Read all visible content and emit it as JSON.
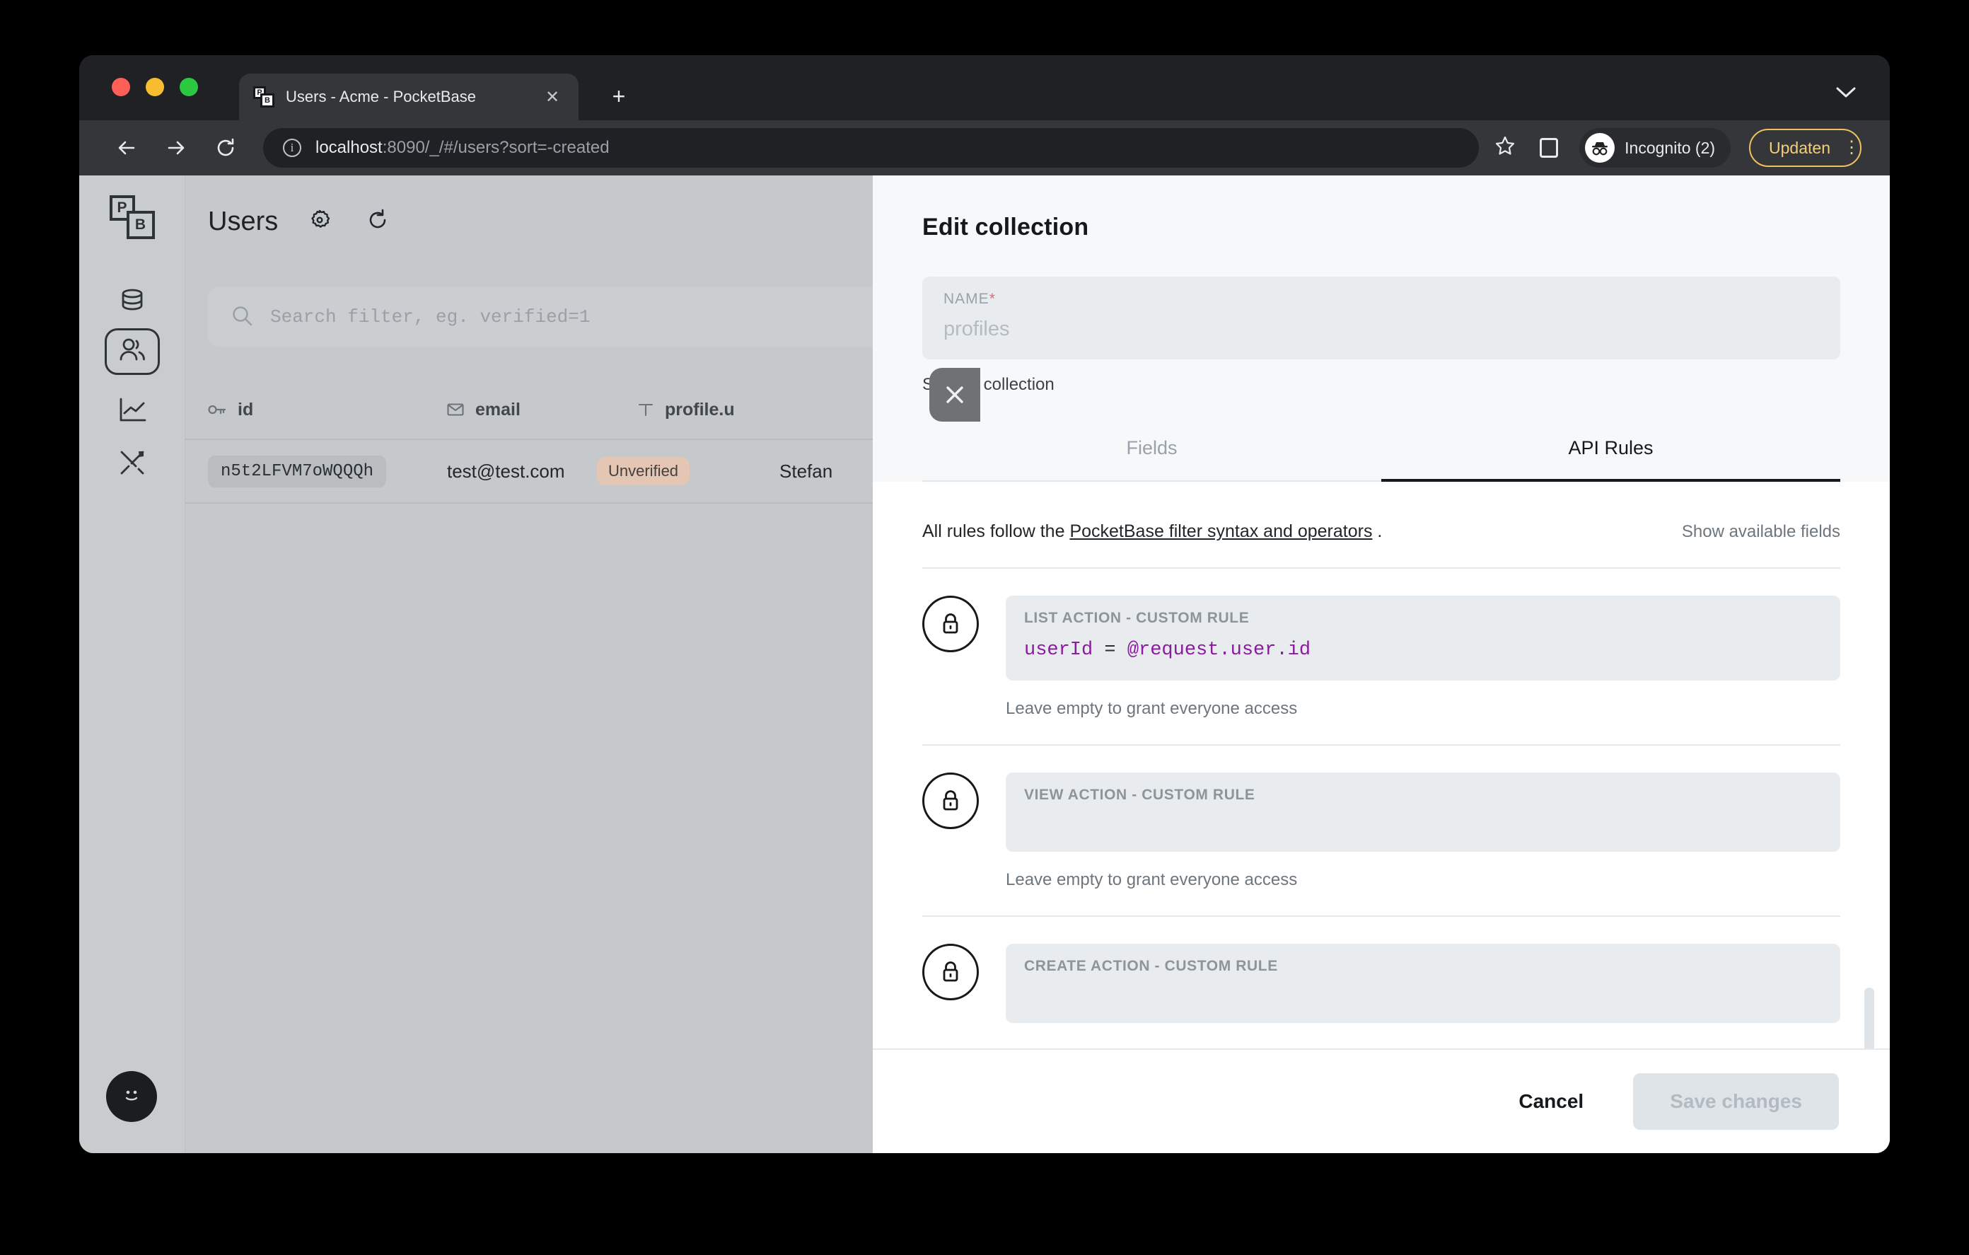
{
  "browser": {
    "tab": {
      "title": "Users - Acme - PocketBase",
      "favicon": "pocketbase-logo-icon",
      "close": "✕"
    },
    "new_tab": "+",
    "window_chevron": "⌄",
    "nav": {
      "back": "←",
      "forward": "→",
      "reload": "↻"
    },
    "omnibox": {
      "info_icon": "i",
      "url_host": "localhost",
      "url_rest": ":8090/_/#/users?sort=-created"
    },
    "star": "☆",
    "profile": {
      "label": "Incognito (2)"
    },
    "update": {
      "label": "Updaten",
      "menu": "⋮",
      "accent": "#f5cf78"
    }
  },
  "sidebar": {
    "logo": {
      "p": "P",
      "b": "B"
    },
    "items": [
      {
        "name": "collections",
        "icon": "database-icon"
      },
      {
        "name": "users",
        "icon": "users-icon",
        "active": true
      },
      {
        "name": "logs",
        "icon": "chart-line-icon"
      },
      {
        "name": "settings",
        "icon": "tools-icon"
      }
    ],
    "help": {
      "icon": "smiley-icon"
    }
  },
  "users_page": {
    "title": "Users",
    "settings_icon": "gear-icon",
    "refresh_icon": "refresh-icon",
    "search": {
      "icon": "search-icon",
      "placeholder": "Search filter, eg. verified=1",
      "value": ""
    },
    "columns": [
      {
        "key": "id",
        "label": "id",
        "icon": "key-icon"
      },
      {
        "key": "email",
        "label": "email",
        "icon": "envelope-icon"
      },
      {
        "key": "profile",
        "label": "profile.u",
        "icon": "text-type-icon"
      }
    ],
    "rows": [
      {
        "id": "n5t2LFVM7oWQQQh",
        "email": "test@test.com",
        "badge": "Unverified",
        "profile": "Stefan"
      }
    ]
  },
  "panel": {
    "close_icon": "close-icon",
    "heading": "Edit collection",
    "name_field": {
      "label": "NAME",
      "required_mark": "*",
      "value": "profiles"
    },
    "system_note": "System collection",
    "tabs": [
      {
        "label": "Fields",
        "active": false
      },
      {
        "label": "API Rules",
        "active": true
      }
    ],
    "rules_intro": {
      "prefix": "All rules follow the ",
      "link": "PocketBase filter syntax and operators",
      "suffix": " ."
    },
    "show_available_fields": "Show available fields",
    "rules": [
      {
        "lock_icon": "lock-icon",
        "label": "LIST ACTION - CUSTOM RULE",
        "value_left": "userId",
        "value_op": " = ",
        "value_right": "@request.user.id",
        "hint": "Leave empty to grant everyone access"
      },
      {
        "lock_icon": "lock-icon",
        "label": "VIEW ACTION - CUSTOM RULE",
        "value_left": "",
        "value_op": "",
        "value_right": "",
        "hint": "Leave empty to grant everyone access"
      },
      {
        "lock_icon": "lock-icon",
        "label": "CREATE ACTION - CUSTOM RULE",
        "value_left": "",
        "value_op": "",
        "value_right": "",
        "hint": ""
      }
    ],
    "footer": {
      "cancel": "Cancel",
      "save": "Save changes"
    }
  }
}
